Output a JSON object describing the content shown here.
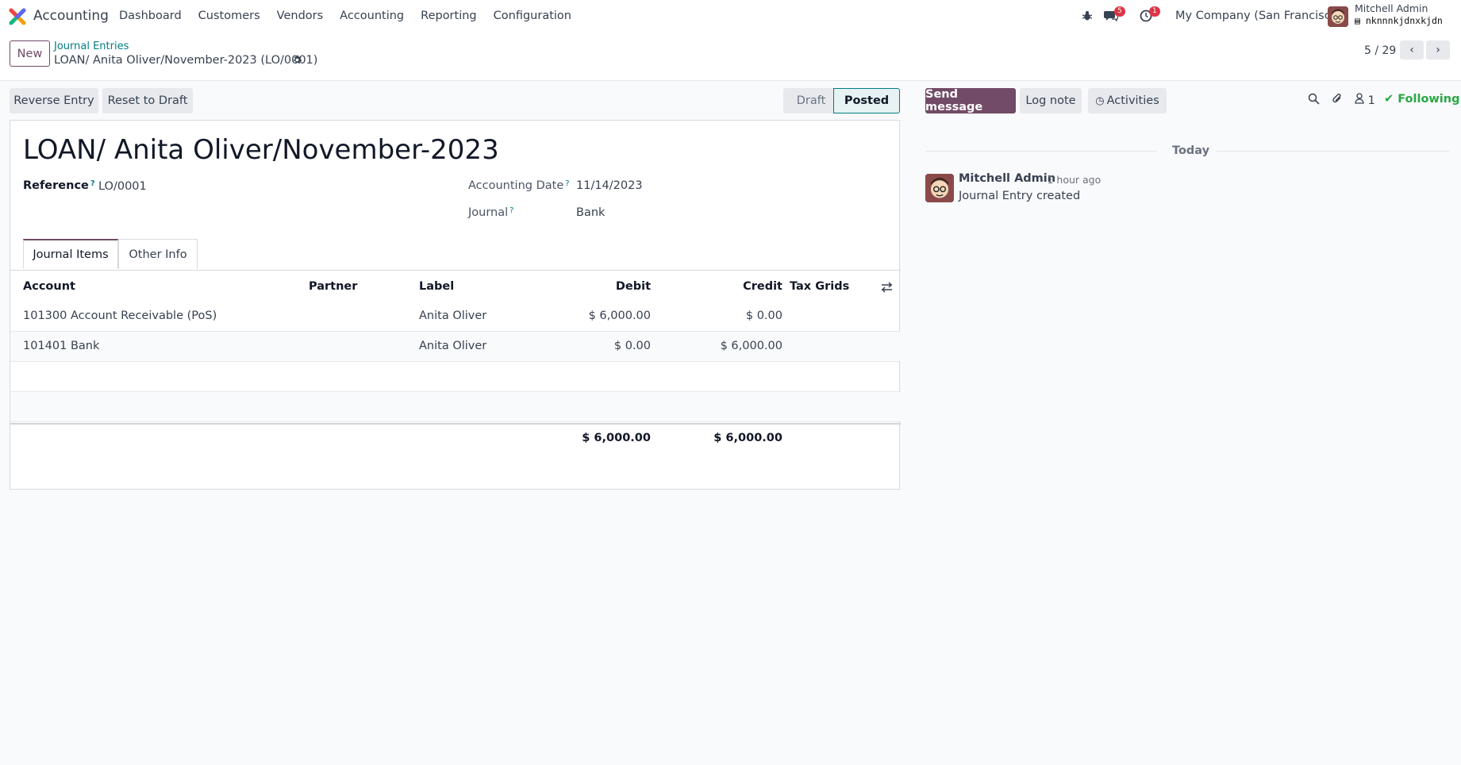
{
  "navbar": {
    "app_name": "Accounting",
    "menu": [
      "Dashboard",
      "Customers",
      "Vendors",
      "Accounting",
      "Reporting",
      "Configuration"
    ],
    "messages_count": "5",
    "activities_count": "1",
    "company": "My Company (San Francisco)",
    "user_name": "Mitchell Admin",
    "db_name": "nknnnkjdnxkjdn"
  },
  "control": {
    "new_label": "New",
    "breadcrumb_parent": "Journal Entries",
    "breadcrumb_current": "LOAN/ Anita Oliver/November-2023 (LO/0001)",
    "pager": "5 / 29"
  },
  "actions": {
    "reverse_entry": "Reverse Entry",
    "reset_to_draft": "Reset to Draft",
    "status_draft": "Draft",
    "status_posted": "Posted"
  },
  "form": {
    "title": "LOAN/ Anita Oliver/November-2023",
    "reference_label": "Reference",
    "reference_value": "LO/0001",
    "accounting_date_label": "Accounting Date",
    "accounting_date_value": "11/14/2023",
    "journal_label": "Journal",
    "journal_value": "Bank",
    "help_mark": "?"
  },
  "tabs": {
    "journal_items": "Journal Items",
    "other_info": "Other Info"
  },
  "table": {
    "headers": {
      "account": "Account",
      "partner": "Partner",
      "label": "Label",
      "debit": "Debit",
      "credit": "Credit",
      "tax_grids": "Tax Grids"
    },
    "rows": [
      {
        "account": "101300 Account Receivable (PoS)",
        "partner": "",
        "label": "Anita Oliver",
        "debit": "$ 6,000.00",
        "credit": "$ 0.00",
        "tax_grids": ""
      },
      {
        "account": "101401 Bank",
        "partner": "",
        "label": "Anita Oliver",
        "debit": "$ 0.00",
        "credit": "$ 6,000.00",
        "tax_grids": ""
      }
    ],
    "total_debit": "$ 6,000.00",
    "total_credit": "$ 6,000.00"
  },
  "chatter": {
    "send_message": "Send message",
    "log_note": "Log note",
    "activities": "Activities",
    "followers_count": "1",
    "following": "Following",
    "date_separator": "Today",
    "message": {
      "author": "Mitchell Admin",
      "time": "- 1 hour ago",
      "body": "Journal Entry created"
    }
  },
  "colors": {
    "brand": "#714b67",
    "link": "#017e84",
    "following": "#28a745",
    "badge": "#dc3545"
  }
}
